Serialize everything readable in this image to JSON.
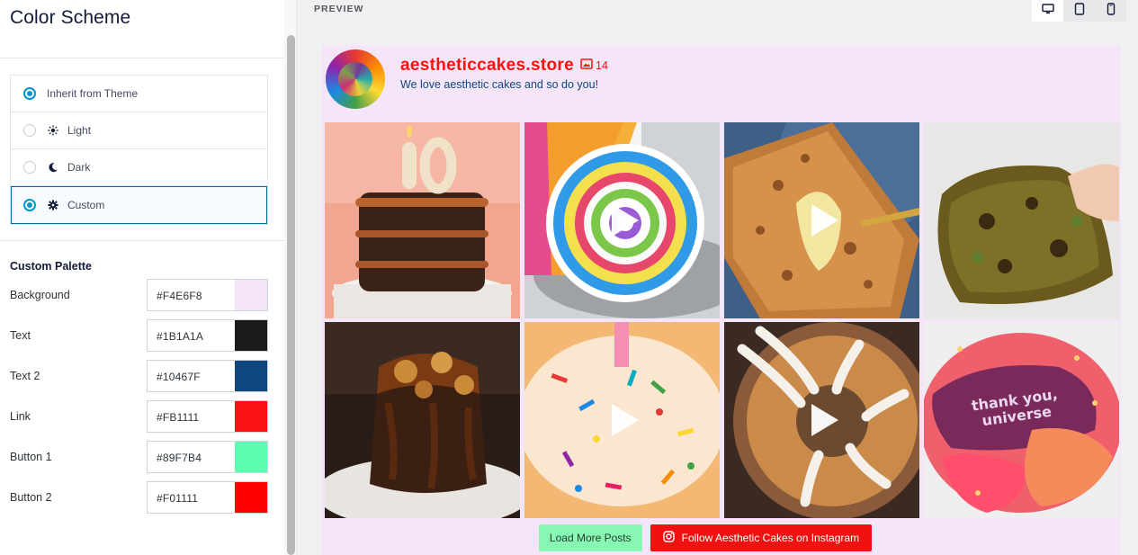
{
  "panel": {
    "title": "Color Scheme",
    "schemes": [
      {
        "label": "Inherit from Theme",
        "icon": "none",
        "selected": false,
        "radio_style": "active-ring"
      },
      {
        "label": "Light",
        "icon": "sun-icon",
        "selected": false
      },
      {
        "label": "Dark",
        "icon": "moon-icon",
        "selected": false
      },
      {
        "label": "Custom",
        "icon": "gear-icon",
        "selected": true
      }
    ],
    "palette_title": "Custom Palette",
    "palette": [
      {
        "label": "Background",
        "value": "#F4E6F8",
        "color": "#F4E6F8"
      },
      {
        "label": "Text",
        "value": "#1B1A1A",
        "color": "#1B1A1A"
      },
      {
        "label": "Text 2",
        "value": "#10467F",
        "color": "#10467F"
      },
      {
        "label": "Link",
        "value": "#FB1111",
        "color": "#FB1111"
      },
      {
        "label": "Button 1",
        "value": "#89F7B4",
        "color": "#5CFDB0"
      },
      {
        "label": "Button 2",
        "value": "#F01111",
        "color": "#FF0000"
      }
    ]
  },
  "preview": {
    "label": "PREVIEW",
    "devices": [
      {
        "name": "desktop",
        "icon": "desktop-icon",
        "active": true
      },
      {
        "name": "tablet",
        "icon": "tablet-icon",
        "active": false
      },
      {
        "name": "mobile",
        "icon": "mobile-icon",
        "active": false
      }
    ]
  },
  "feed": {
    "background": "#F4E6F8",
    "handle": "aestheticcakes.store",
    "post_count": "14",
    "bio": "We love aesthetic cakes and so do you!",
    "posts": [
      {
        "subject": "chocolate layer cake with number 10 candle",
        "video": false
      },
      {
        "subject": "rainbow swiss roll",
        "video": true
      },
      {
        "subject": "crumble pie slice with custard",
        "video": true
      },
      {
        "subject": "matcha chocolate brownie",
        "video": false
      },
      {
        "subject": "caramel pecan chocolate brownie",
        "video": false
      },
      {
        "subject": "sprinkle donut with candle",
        "video": true
      },
      {
        "subject": "glazed bundt cake",
        "video": true
      },
      {
        "subject": "pink thank you universe cake",
        "video": false,
        "cake_text": "thank you, universe"
      }
    ],
    "load_more_label": "Load More Posts",
    "follow_label": "Follow Aesthetic Cakes on Instagram",
    "colors": {
      "link": "#FB1111",
      "text2": "#10467F",
      "button1": "#89F7B4",
      "button2": "#F01111"
    }
  }
}
